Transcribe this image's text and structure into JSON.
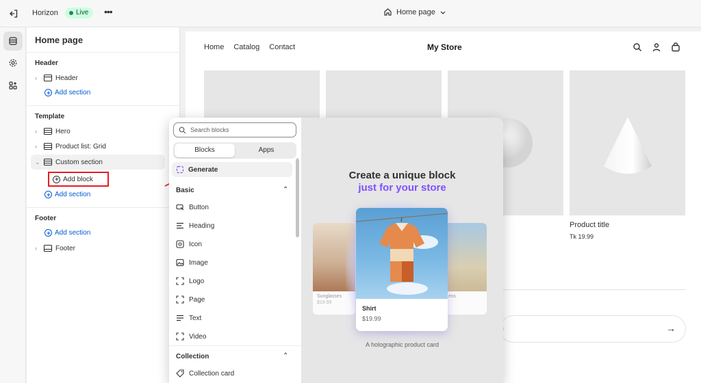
{
  "topbar": {
    "theme_name": "Horizon",
    "status": "Live",
    "page_selector": "Home page",
    "more": "•••"
  },
  "sidebar": {
    "page_title": "Home page",
    "header_group": {
      "title": "Header",
      "items": [
        "Header"
      ],
      "add_section": "Add section"
    },
    "template_group": {
      "title": "Template",
      "items": [
        "Hero",
        "Product list: Grid",
        "Custom section"
      ],
      "add_block": "Add block",
      "add_section": "Add section"
    },
    "footer_group": {
      "title": "Footer",
      "add_section": "Add section",
      "items": [
        "Footer"
      ]
    }
  },
  "preview": {
    "nav": [
      "Home",
      "Catalog",
      "Contact"
    ],
    "store_name": "My Store",
    "product_title": "Product title",
    "product_price": "Tk 19.99",
    "subscribe_partial": "s"
  },
  "block_picker": {
    "search_placeholder": "Search blocks",
    "tabs": [
      "Blocks",
      "Apps"
    ],
    "generate": "Generate",
    "basic_title": "Basic",
    "basic_items": [
      "Button",
      "Heading",
      "Icon",
      "Image",
      "Logo",
      "Page",
      "Text",
      "Video"
    ],
    "collection_title": "Collection",
    "collection_items": [
      "Collection card"
    ],
    "promo": {
      "title": "Create a unique block",
      "subtitle": "just for your store",
      "card_left_name": "Sunglasses",
      "card_left_price": "$19.99",
      "card_right_name": "ess",
      "card_main_name": "Shirt",
      "card_main_price": "$19.99",
      "caption": "A holographic product card"
    }
  },
  "colors": {
    "accent_link": "#005bd3",
    "live_badge": "#cdfee1",
    "highlight_box": "#e51c23",
    "promo_purple": "#8051ff"
  }
}
